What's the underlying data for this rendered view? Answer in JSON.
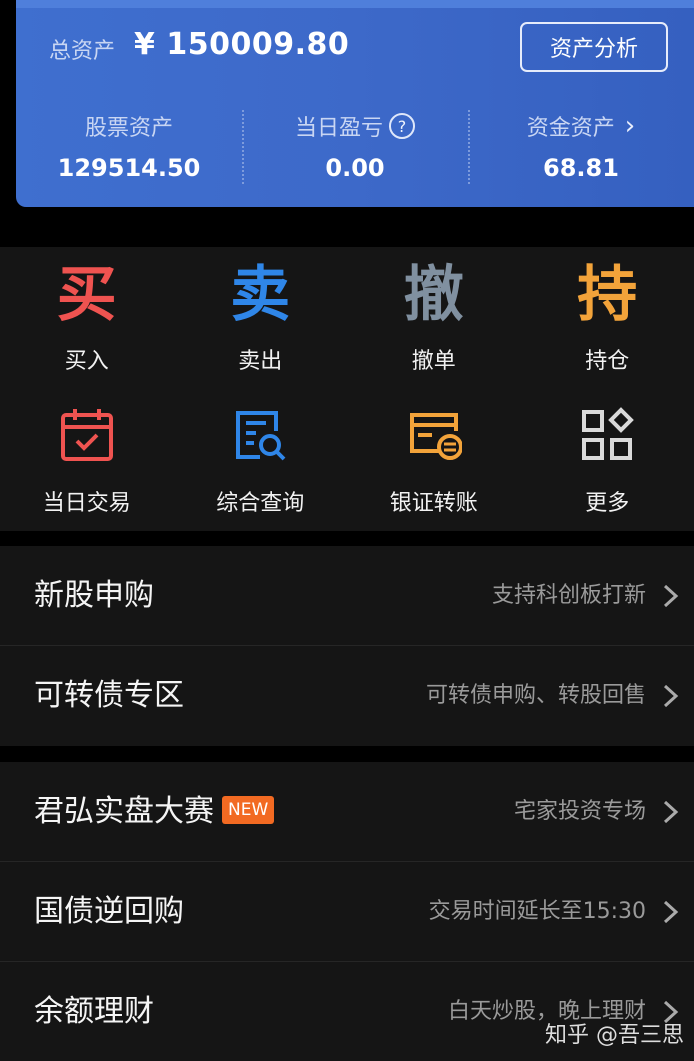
{
  "assets": {
    "total_label": "总资产",
    "total_value": "¥ 150009.80",
    "analysis_button": "资产分析",
    "stats": [
      {
        "label": "股票资产",
        "value": "129514.50"
      },
      {
        "label": "当日盈亏",
        "value": "0.00",
        "help_icon": "?"
      },
      {
        "label": "资金资产",
        "value": "68.81",
        "chevron": "›"
      }
    ]
  },
  "actions": [
    {
      "char": "买",
      "label": "买入",
      "color": "#ef5350"
    },
    {
      "char": "卖",
      "label": "卖出",
      "color": "#2f86e8"
    },
    {
      "char": "撤",
      "label": "撤单",
      "color": "#8090a0"
    },
    {
      "char": "持",
      "label": "持仓",
      "color": "#f2a33a"
    }
  ],
  "tools": [
    {
      "icon": "calendar-check-icon",
      "label": "当日交易",
      "color": "#ef5350"
    },
    {
      "icon": "search-document-icon",
      "label": "综合查询",
      "color": "#2f86e8"
    },
    {
      "icon": "bank-card-transfer-icon",
      "label": "银证转账",
      "color": "#f2a33a"
    },
    {
      "icon": "grid-more-icon",
      "label": "更多",
      "color": "#d9d9d9"
    }
  ],
  "menu_group_1": [
    {
      "title": "新股申购",
      "subtitle": "支持科创板打新"
    },
    {
      "title": "可转债专区",
      "subtitle": "可转债申购、转股回售"
    }
  ],
  "menu_group_2": [
    {
      "title": "君弘实盘大赛",
      "badge": "NEW",
      "subtitle": "宅家投资专场"
    },
    {
      "title": "国债逆回购",
      "subtitle": "交易时间延长至15:30"
    },
    {
      "title": "余额理财",
      "subtitle": "白天炒股，晚上理财"
    }
  ],
  "watermark": "知乎 @吾三思"
}
